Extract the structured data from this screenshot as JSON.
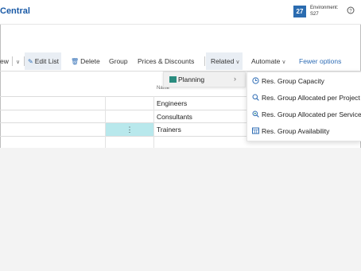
{
  "header": {
    "app_title": "Central",
    "env_badge": "27",
    "env_label": "Environment:",
    "env_name": "S27",
    "help_icon": "question-icon"
  },
  "toolbar": {
    "view_label": "ew",
    "edit_list_label": "Edit List",
    "delete_label": "Delete",
    "group_label": "Group",
    "prices_label": "Prices & Discounts",
    "related_label": "Related",
    "automate_label": "Automate",
    "fewer_options_label": "Fewer options"
  },
  "table": {
    "column_name": "Name",
    "rows": [
      "Engineers",
      "Consultants",
      "Trainers"
    ],
    "row_menu_glyph": "⋮"
  },
  "related_menu": {
    "planning_label": "Planning",
    "planning_icon": "planning-icon"
  },
  "planning_submenu": {
    "items": [
      {
        "label": "Res. Group Capacity",
        "icon": "capacity-icon"
      },
      {
        "label": "Res. Group Allocated per Project",
        "icon": "allocation-icon"
      },
      {
        "label": "Res. Group Allocated per Service O",
        "icon": "service-allocation-icon"
      },
      {
        "label": "Res. Group Availability",
        "icon": "availability-icon"
      }
    ]
  },
  "colors": {
    "accent": "#1a5aa6",
    "selected_cell": "#b8e8ec",
    "menu_hover": "#f0f0f0"
  }
}
